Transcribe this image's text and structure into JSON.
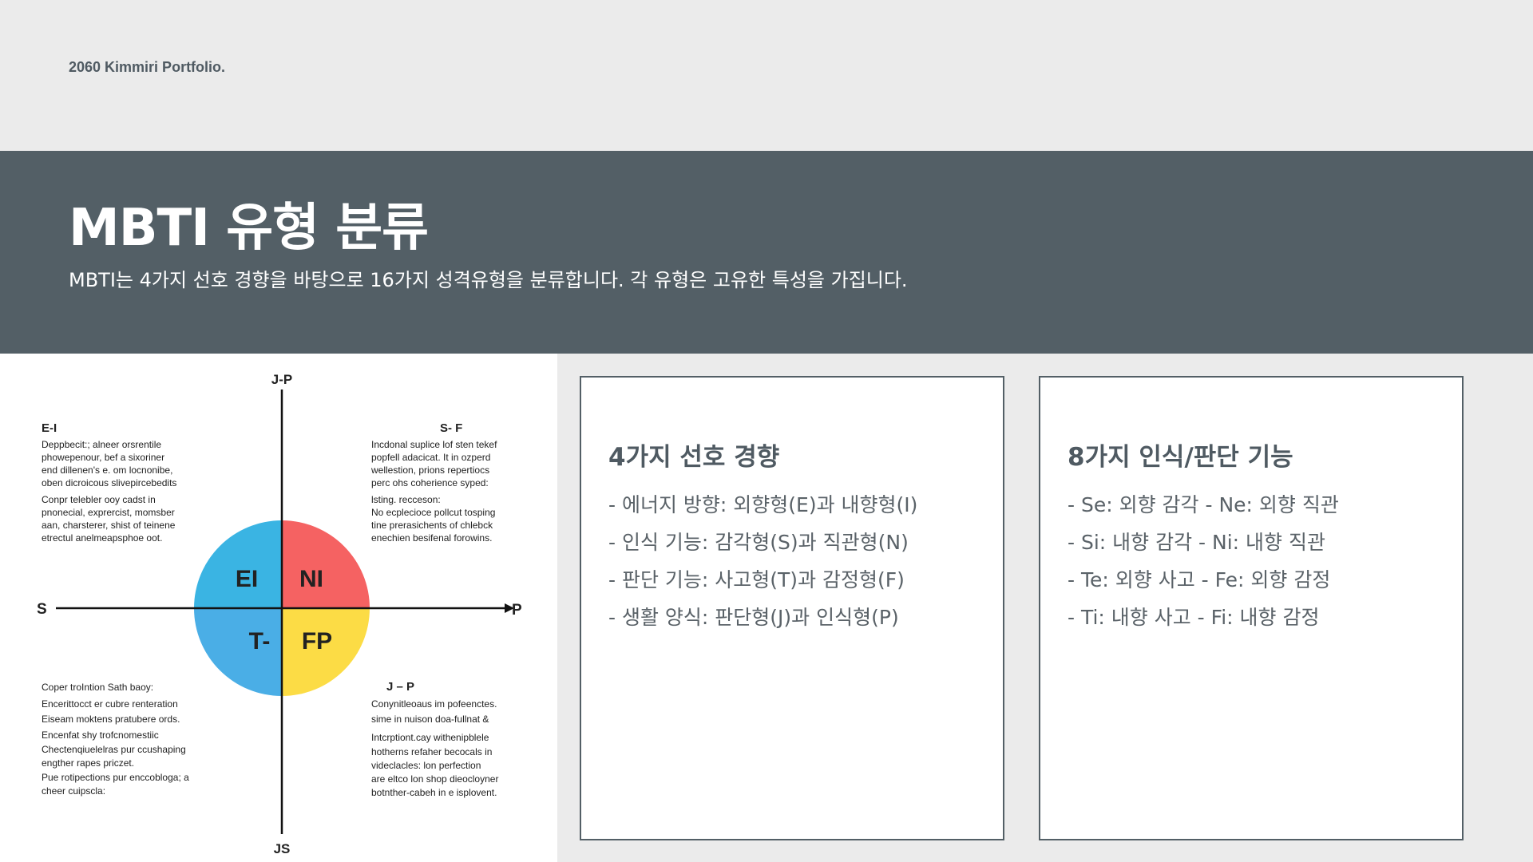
{
  "header": {
    "portfolio_label": "2060 Kimmiri Portfolio."
  },
  "banner": {
    "title": "MBTI 유형 분류",
    "subtitle": "MBTI는 4가지 선호 경향을 바탕으로 16가지 성격유형을 분류합니다. 각 유형은 고유한 특성을 가집니다."
  },
  "diagram": {
    "axis_top": "J-P",
    "axis_bottom": "JS",
    "axis_left": "S",
    "axis_right": "P",
    "quadrants": [
      {
        "label": "EI",
        "color": "#3ab4e3"
      },
      {
        "label": "NI",
        "color": "#f56262"
      },
      {
        "label": "T-",
        "color": "#4aaee6"
      },
      {
        "label": "FP",
        "color": "#fcdc45"
      }
    ],
    "blocks": {
      "top_left": {
        "heading": "E-I",
        "lines": [
          "Deppbecit:; alneer orsrentile",
          "phowepenour, bef a sixoriner",
          "end dillenen's e. om locnonibe,",
          "oben dicroicous slivepircebedits",
          "",
          "Conpr telebler ooy cadst in",
          "pnonecial, exprercist, momsber",
          "aan, charsterer, shist of teinene",
          "etrectul anelmeapsphoe oot."
        ]
      },
      "top_right": {
        "heading": "S- F",
        "lines": [
          "Incdonal suplice lof sten tekef",
          "popfell adacicat. It in ozperd",
          "wellestion, prions repertiocs",
          "perc ohs coherience syped:",
          "",
          "lsting. recceson:",
          "No ecplecioce pollcut tosping",
          "tine prerasichents of chlebck",
          "enechien besifenal forowins."
        ]
      },
      "bottom_left": {
        "heading": "",
        "lines": [
          "Coper troIntion Sath baoy:",
          "Encerittocct er cubre renteration",
          "Eiseam moktens pratubere ords.",
          "Encenfat shy trofcnomestiic",
          "Chectenqiuelelras pur ccushaping",
          "engther rapes priczet.",
          "Pue rotipections pur enccobloga; a",
          "cheer cuipscla:"
        ]
      },
      "bottom_right": {
        "heading": "J – P",
        "lines": [
          "Conynitleoaus im pofeenctes.",
          "sime in nuison doa-fullnat &",
          "Intcrptiont.cay withenipblele",
          "hotherns refaher becocals in",
          "videclacles: lon perfection",
          "are eltco lon shop dieocloyner",
          "botnther-cabeh in e isplovent."
        ]
      }
    }
  },
  "cards": [
    {
      "title": "4가지 선호 경향",
      "items": [
        "- 에너지 방향: 외향형(E)과 내향형(I)",
        "- 인식 기능: 감각형(S)과 직관형(N)",
        "- 판단 기능: 사고형(T)과 감정형(F)",
        "- 생활 양식: 판단형(J)과 인식형(P)"
      ]
    },
    {
      "title": "8가지 인식/판단 기능",
      "items": [
        "- Se: 외향 감각 - Ne: 외향 직관",
        "- Si: 내향 감각 - Ni: 내향 직관",
        "- Te: 외향 사고 - Fe: 외향 감정",
        "- Ti: 내향 사고 - Fi: 내향 감정"
      ]
    }
  ]
}
